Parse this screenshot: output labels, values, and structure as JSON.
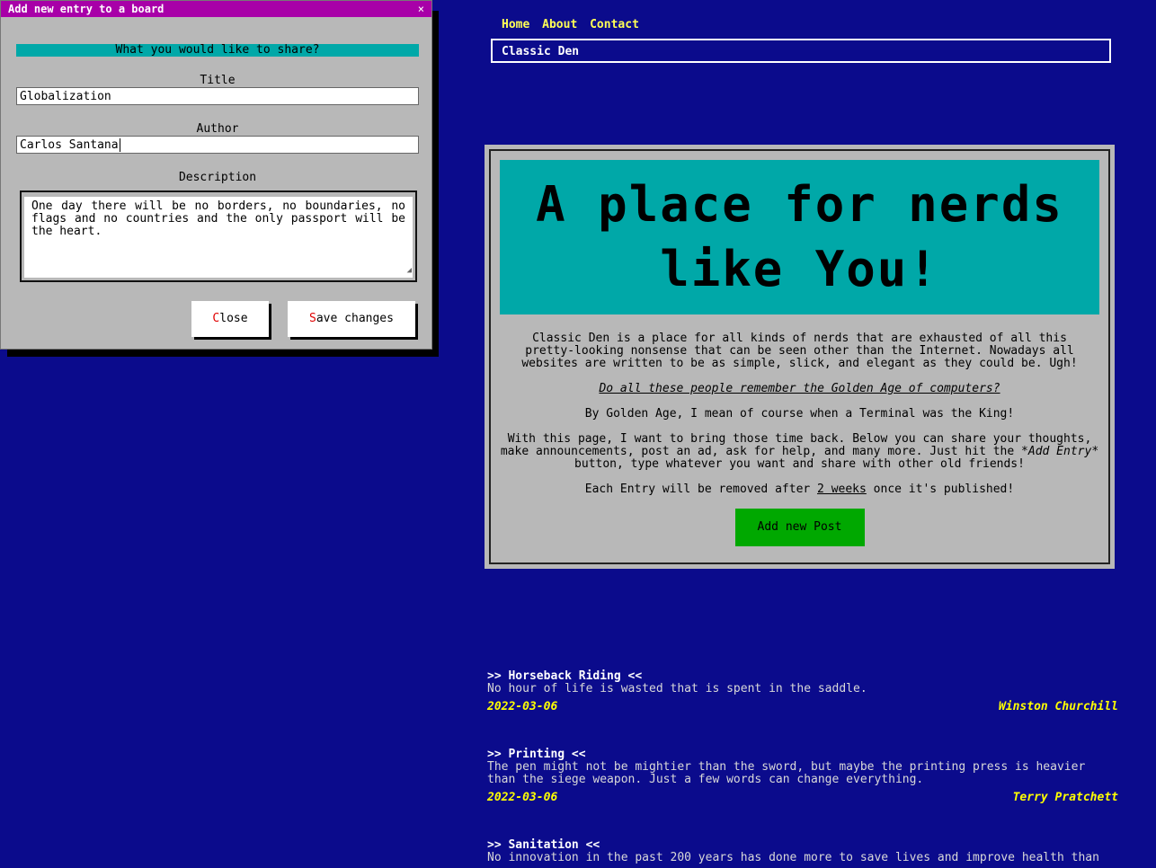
{
  "nav": {
    "links": [
      "Home",
      "About",
      "Contact"
    ],
    "brand": "Classic Den"
  },
  "hero": {
    "banner_line1": "A place for nerds",
    "banner_line2": "like You!",
    "intro": "Classic Den is a place for all kinds of nerds that are exhausted of all this pretty-looking nonsense that can be seen other than the Internet. Nowadays all websites are written to be as simple, slick, and elegant as they could be. Ugh!",
    "question": "Do all these people remember the Golden Age of computers?",
    "golden": "By Golden Age, I mean of course when a Terminal was the King!",
    "purpose_start": "With this page, I want to bring those time back. Below you can share your thoughts, make announcements, post an ad, ask for help, and many more. Just hit the ",
    "purpose_button_ref": "*Add Entry*",
    "purpose_end": " button, type whatever you want and share with other old friends!",
    "removal_start": "Each Entry will be removed after ",
    "removal_period": "2 weeks",
    "removal_end": " once it's published!",
    "add_button": "Add new Post"
  },
  "posts": [
    {
      "title": ">> Horseback Riding <<",
      "body": "No hour of life is wasted that is spent in the saddle.",
      "date": "2022-03-06",
      "author": "Winston Churchill"
    },
    {
      "title": ">> Printing <<",
      "body": "The pen might not be mightier than the sword, but maybe the printing press is heavier than the siege weapon. Just a few words can change everything.",
      "date": "2022-03-06",
      "author": "Terry Pratchett"
    },
    {
      "title": ">> Sanitation <<",
      "body": "No innovation in the past 200 years has done more to save lives and improve health than"
    }
  ],
  "modal": {
    "title": "Add new entry to a board",
    "close_glyph": "×",
    "prompt": "What you would like to share?",
    "title_label": "Title",
    "title_value": "Globalization",
    "author_label": "Author",
    "author_value": "Carlos Santana",
    "description_label": "Description",
    "description_value": "One day there will be no borders, no boundaries, no flags and no countries and the only passport will be the heart.",
    "close_hotkey": "C",
    "close_rest": "lose",
    "save_hotkey": "S",
    "save_rest": "ave changes"
  },
  "colors": {
    "background": "#0b0b8c",
    "nav_link": "#ffff55",
    "banner": "#00a8a8",
    "add_button": "#00a800",
    "modal_titlebar": "#a800a8",
    "post_meta": "#ffff00",
    "hotkey": "#e00000"
  }
}
